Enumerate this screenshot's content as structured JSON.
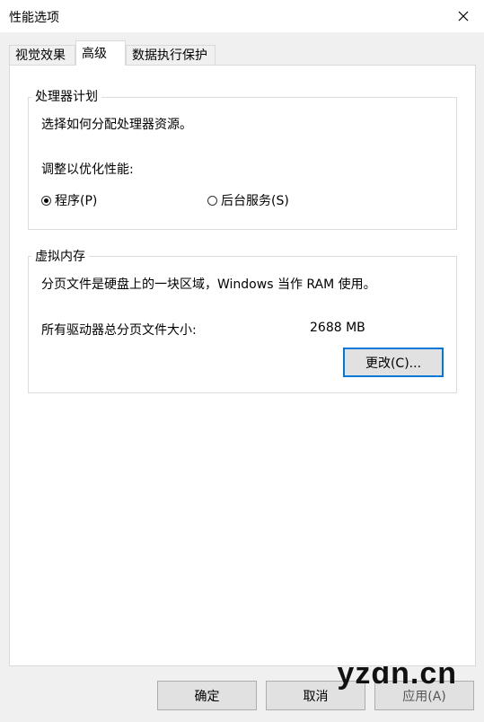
{
  "window": {
    "title": "性能选项"
  },
  "tabs": [
    {
      "label": "视觉效果"
    },
    {
      "label": "高级"
    },
    {
      "label": "数据执行保护"
    }
  ],
  "processor": {
    "legend": "处理器计划",
    "description": "选择如何分配处理器资源。",
    "adjust_label": "调整以优化性能:",
    "options": [
      {
        "label": "程序(P)",
        "selected": true
      },
      {
        "label": "后台服务(S)",
        "selected": false
      }
    ]
  },
  "virtual_memory": {
    "legend": "虚拟内存",
    "description": "分页文件是硬盘上的一块区域，Windows 当作 RAM 使用。",
    "total_label": "所有驱动器总分页文件大小:",
    "total_value": "2688 MB",
    "change_button": "更改(C)..."
  },
  "footer": {
    "ok": "确定",
    "cancel": "取消",
    "apply": "应用(A)"
  },
  "watermark": "yzdn.cn",
  "colors": {
    "focus": "#0078d7",
    "panel_bg": "#ffffff",
    "window_bg": "#f0f0f0"
  }
}
